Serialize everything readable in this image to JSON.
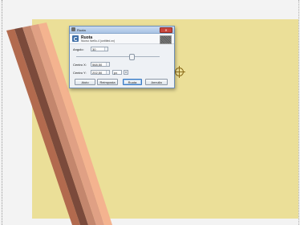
{
  "dialog": {
    "title": "Ruota",
    "close_label": "✕",
    "header_title": "Ruota",
    "header_subtitle": "Nuovo livello-4 (untitled-xx)",
    "angle_label": "Angolo:",
    "angle_value": "30",
    "center_x_label": "Centro X:",
    "center_x_value": "568,50",
    "center_y_label": "Centro Y:",
    "center_y_value": "202,50",
    "unit_value": "px",
    "buttons": {
      "help": "Aiuto",
      "reset": "Reimposta",
      "rotate": "Ruota",
      "cancel": "Annulla"
    }
  },
  "colors": {
    "canvas_bg": "#f3f3f3",
    "layer_fill": "#ebdf98",
    "stripes": [
      "#b26a4e",
      "#7b4a3b",
      "#c3866d",
      "#e0a084",
      "#f4b38f"
    ]
  },
  "icons": [
    "app-icon",
    "rotate-icon",
    "preview-thumbnail-icon",
    "close-icon",
    "pivot-crosshair-icon",
    "chevron-down-icon"
  ]
}
